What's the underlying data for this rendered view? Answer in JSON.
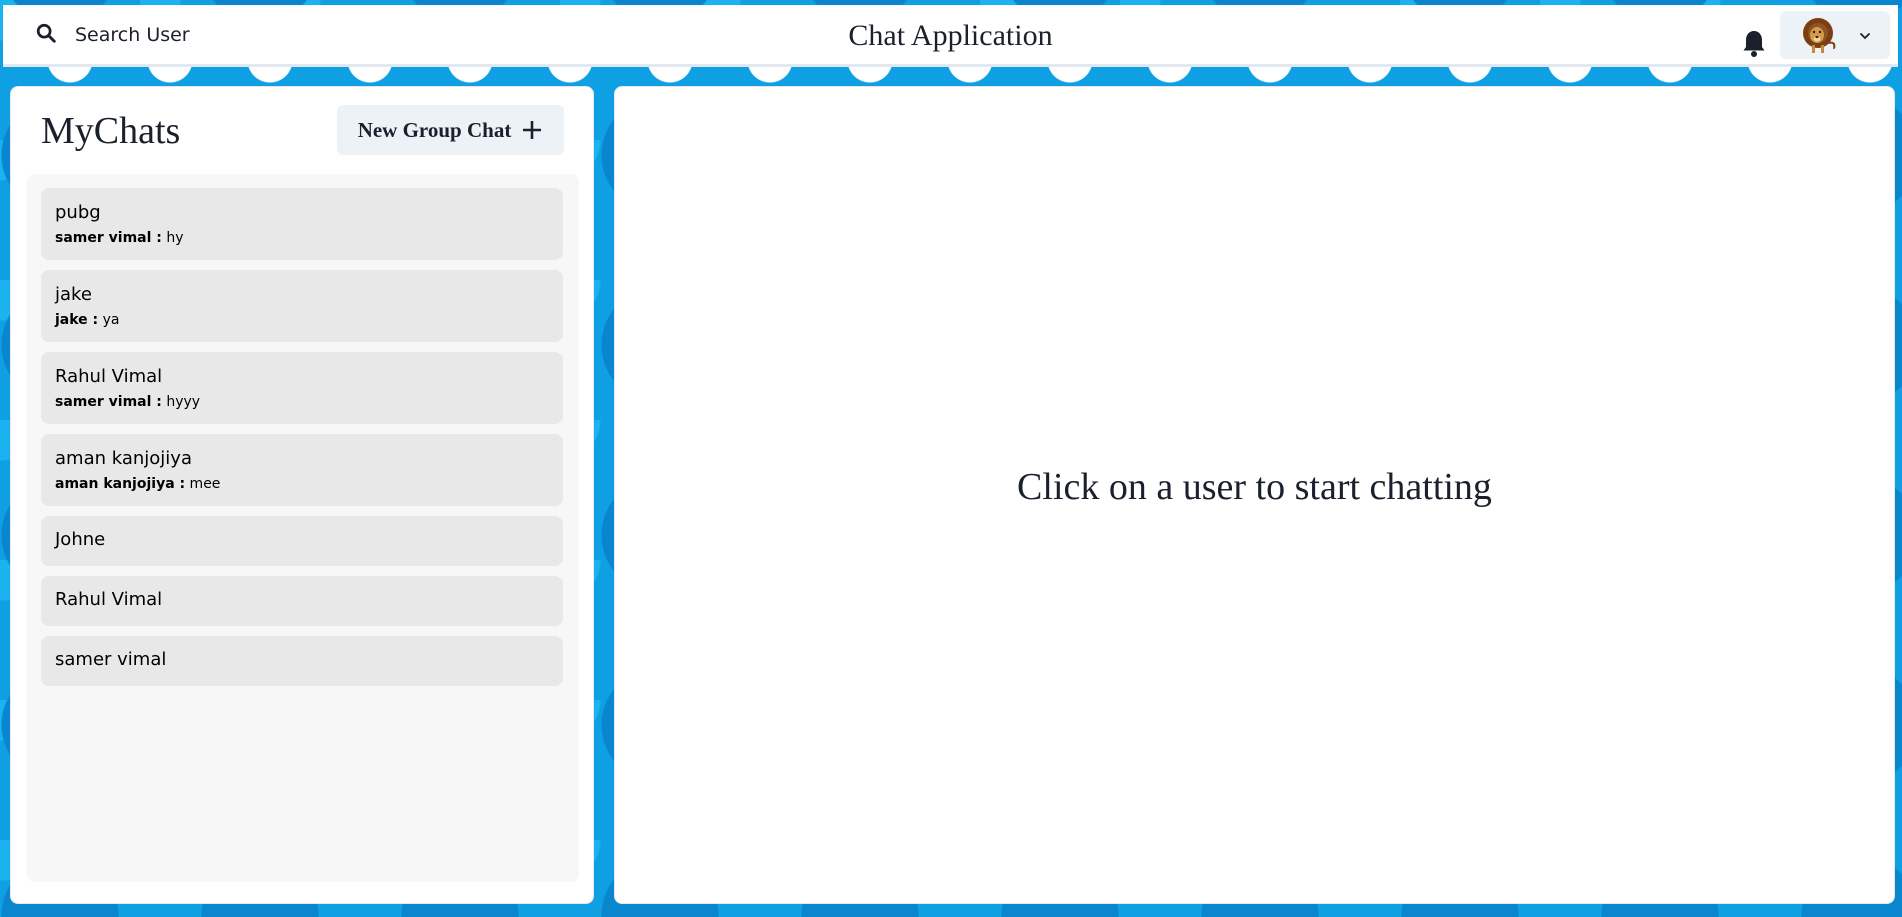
{
  "header": {
    "search_label": "Search User",
    "app_title": "Chat Application",
    "search_icon": "search-icon",
    "notification_icon": "bell-icon",
    "profile_avatar": "lion-avatar",
    "profile_menu_icon": "chevron-down-icon"
  },
  "chats": {
    "title": "MyChats",
    "new_group_label": "New Group Chat",
    "new_group_icon": "plus-icon",
    "items": [
      {
        "name": "pubg",
        "sender": "samer vimal :",
        "message": " hy"
      },
      {
        "name": "jake",
        "sender": "jake :",
        "message": " ya"
      },
      {
        "name": "Rahul Vimal",
        "sender": "samer vimal :",
        "message": " hyyy"
      },
      {
        "name": "aman kanjojiya",
        "sender": "aman kanjojiya :",
        "message": " mee"
      },
      {
        "name": "Johne"
      },
      {
        "name": "Rahul Vimal"
      },
      {
        "name": "samer vimal"
      }
    ]
  },
  "chat_window": {
    "empty_message": "Click on a user to start chatting"
  },
  "colors": {
    "background": "#0fa0e4",
    "panel": "#ffffff",
    "list_bg": "#f7f7f7",
    "item_bg": "#e8e8e8",
    "button_bg": "#edf2f7",
    "text": "#1a202c"
  }
}
